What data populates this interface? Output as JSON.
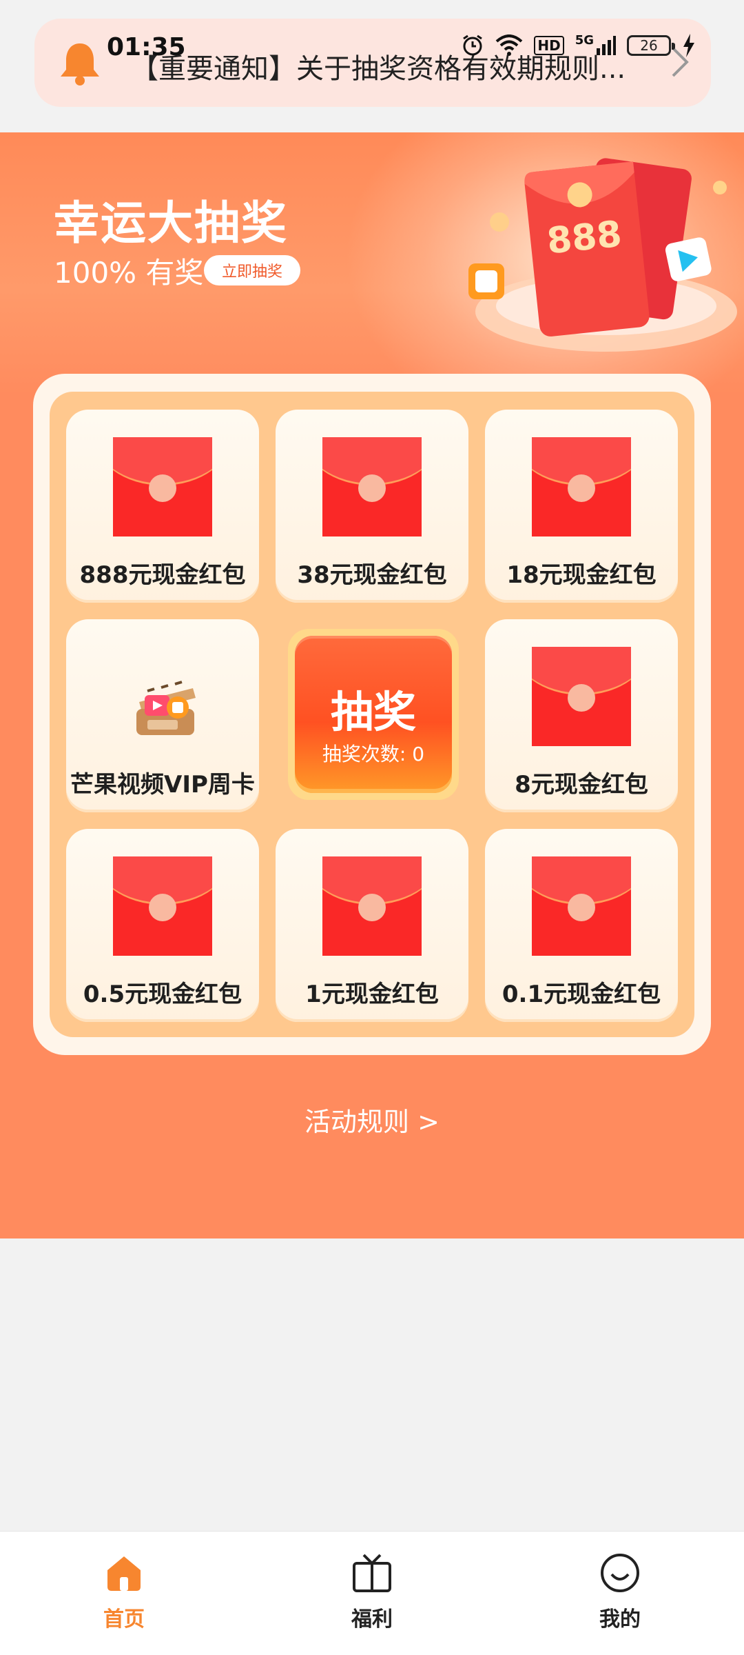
{
  "status_bar": {
    "time": "01:35",
    "network": "5G",
    "hd": "HD",
    "battery": "26"
  },
  "notice": {
    "text": "【重要通知】关于抽奖资格有效期规则..."
  },
  "hero": {
    "title": "幸运大抽奖",
    "subtitle": "100% 有奖",
    "cta_label": "立即抽奖",
    "art_amount": "888"
  },
  "prizes": [
    {
      "label": "888元现金红包",
      "type": "envelope"
    },
    {
      "label": "38元现金红包",
      "type": "envelope"
    },
    {
      "label": "18元现金红包",
      "type": "envelope"
    },
    {
      "label": "芒果视频VIP周卡",
      "type": "vip"
    },
    {
      "label": "8元现金红包",
      "type": "envelope"
    },
    {
      "label": "0.5元现金红包",
      "type": "envelope"
    },
    {
      "label": "1元现金红包",
      "type": "envelope"
    },
    {
      "label": "0.1元现金红包",
      "type": "envelope"
    }
  ],
  "draw": {
    "title": "抽奖",
    "count_text": "抽奖次数: 0"
  },
  "rules": {
    "label": "活动规则 >"
  },
  "nav": {
    "items": [
      {
        "label": "首页",
        "icon": "home-icon",
        "active": true
      },
      {
        "label": "福利",
        "icon": "tv-icon",
        "active": false
      },
      {
        "label": "我的",
        "icon": "smile-icon",
        "active": false
      }
    ]
  },
  "colors": {
    "primary": "#ff8b5e",
    "accent": "#f7862f",
    "envelope": "#fa2827",
    "board": "#ffc88e"
  }
}
